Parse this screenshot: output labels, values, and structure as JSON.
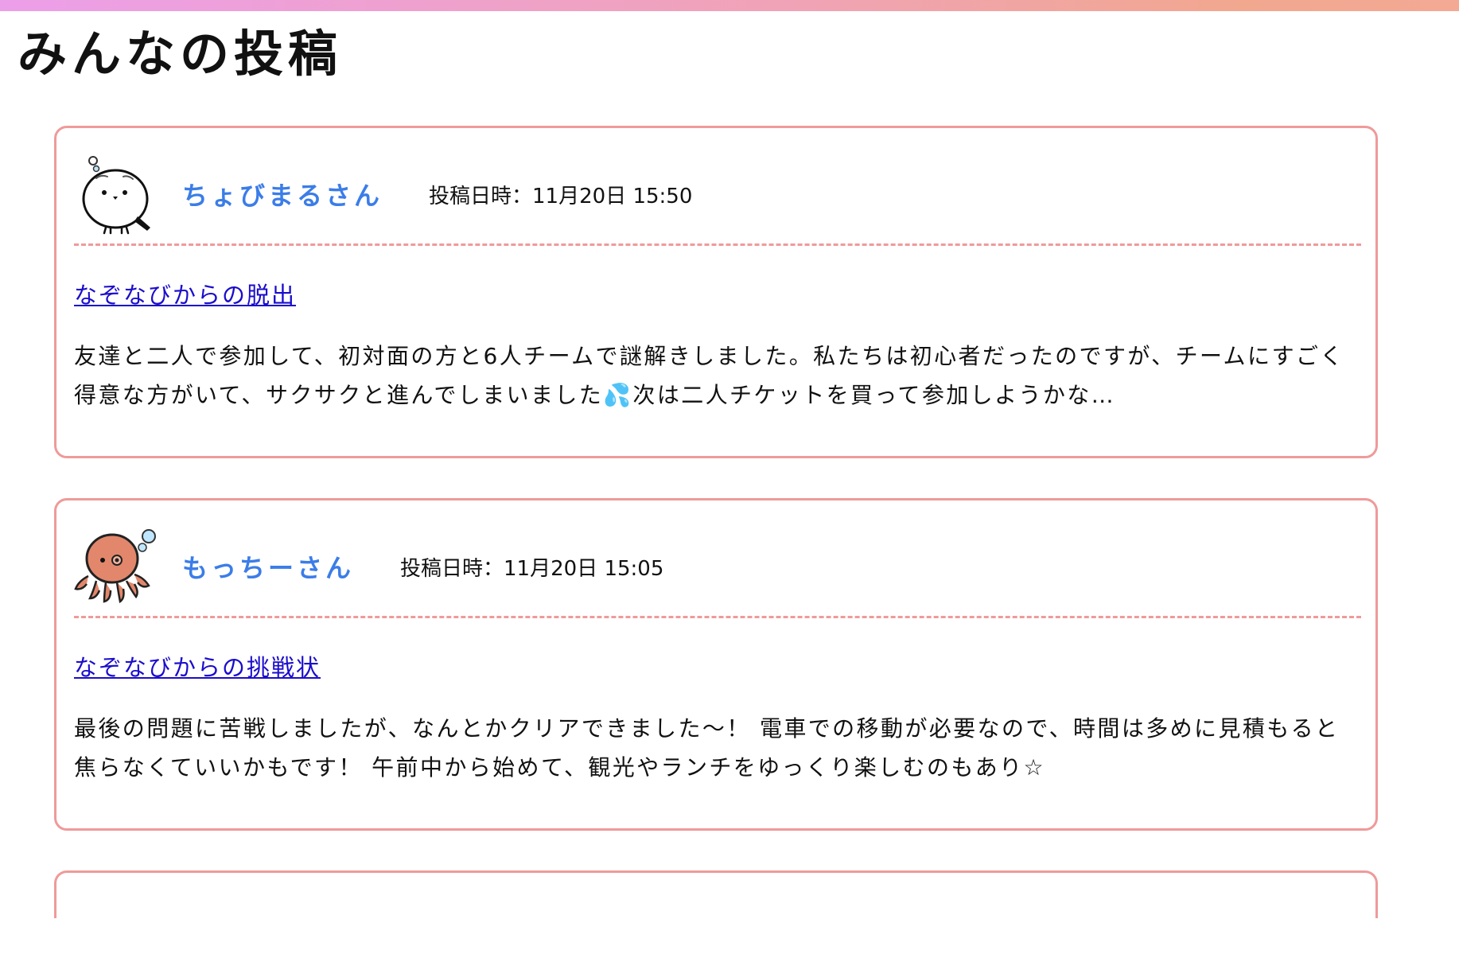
{
  "page": {
    "title": "みんなの投稿"
  },
  "colors": {
    "accent_border": "#ef9a9a",
    "author_name": "#3b7de8",
    "link": "#1a0dcc",
    "top_bar_start": "#ec9fe9",
    "top_bar_end": "#f3a994"
  },
  "posts": [
    {
      "author": "ちょびまるさん",
      "avatar_icon": "long-tailed-tit-bird-icon",
      "date": "投稿日時：11月20日 15:50",
      "link_text": "なぞなびからの脱出",
      "body": "友達と二人で参加して、初対面の方と6人チームで謎解きしました。私たちは初心者だったのですが、チームにすごく得意な方がいて、サクサクと進んでしまいました💦次は二人チケットを買って参加しようかな…"
    },
    {
      "author": "もっちーさん",
      "avatar_icon": "octopus-icon",
      "date": "投稿日時：11月20日 15:05",
      "link_text": "なぞなびからの挑戦状",
      "body": "最後の問題に苦戦しましたが、なんとかクリアできました〜！ 電車での移動が必要なので、時間は多めに見積もると焦らなくていいかもです！ 午前中から始めて、観光やランチをゆっくり楽しむのもあり☆"
    }
  ]
}
